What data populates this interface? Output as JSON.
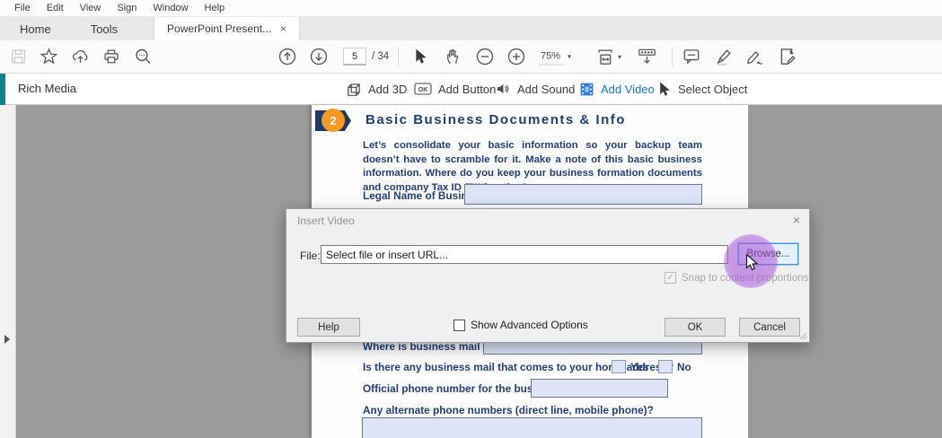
{
  "menubar": {
    "items": [
      "File",
      "Edit",
      "View",
      "Sign",
      "Window",
      "Help"
    ]
  },
  "tabs": {
    "home": "Home",
    "tools": "Tools",
    "document_tab": "PowerPoint Present...",
    "close_glyph": "×"
  },
  "toolbar": {
    "page_current": "5",
    "page_total": "/ 34",
    "zoom_level": "75%",
    "caret_glyph": "▾"
  },
  "richmedia": {
    "title": "Rich Media",
    "add_3d": "Add 3D",
    "add_button": "Add Button",
    "add_button_glyph": "OK",
    "add_sound": "Add Sound",
    "add_video": "Add Video",
    "select_object": "Select Object"
  },
  "document": {
    "section_number": "2",
    "heading": "Basic Business Documents & Info",
    "paragraph": "Let’s consolidate your basic information so your backup team doesn’t have to scramble for it. Make a note of this basic business information. Where do you keep your business formation documents and company Tax ID (EIN) notice?",
    "legal_name_label": "Legal Name of Business:",
    "mail_sent_label": "Where is business mail sent?",
    "home_mail_label": "Is there any business mail that comes to your home address?",
    "yes_label": "Yes",
    "no_label": "No",
    "phone_label": "Official phone number for the business:",
    "alt_phone_label": "Any alternate phone numbers (direct line, mobile phone)?"
  },
  "dialog": {
    "title": "Insert Video",
    "close_glyph": "×",
    "file_label": "File:",
    "file_value": "Select file or insert URL...",
    "browse_label": "Browse...",
    "snap_label": "Snap to content proportions",
    "snap_check_glyph": "✓",
    "help_label": "Help",
    "advanced_label": "Show Advanced Options",
    "ok_label": "OK",
    "cancel_label": "Cancel"
  },
  "colors": {
    "teal_accent": "#17808e",
    "video_blue": "#1477d4",
    "badge_orange": "#f5991f",
    "banner_navy": "#1e3a68",
    "doc_navy": "#24407a",
    "field_lavender": "#dde4f8",
    "click_highlight": "#a855d8"
  },
  "icons": {
    "save": "floppy-outline",
    "star": "star-outline",
    "share": "cloud-up-arrow",
    "print": "printer",
    "search": "magnifier-dots",
    "prev_page": "circle-arrow-up",
    "next_page": "circle-arrow-down",
    "select": "arrow-pointer",
    "pan": "hand",
    "zoom_out": "circle-minus",
    "zoom_in": "circle-plus",
    "page_fit": "page-width-arrows",
    "toolbar_collapse": "bar-down-arrow",
    "comment": "speech-bubble",
    "highlight": "marker-pen",
    "sign": "fountain-pen",
    "fill_sign": "doc-pencil",
    "add_3d": "cube",
    "add_sound": "speaker",
    "add_video": "film-frame-blue",
    "select_object": "arrow-pointer"
  }
}
